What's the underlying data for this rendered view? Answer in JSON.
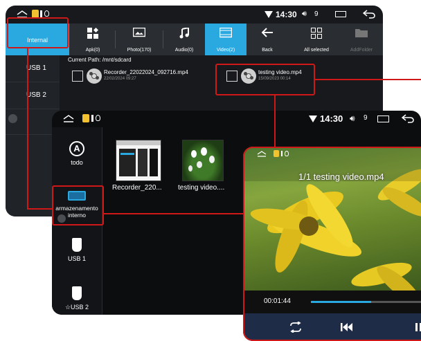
{
  "file_manager": {
    "status": {
      "time": "14:30",
      "volume": "9"
    },
    "tabs": {
      "internal": "Internal",
      "apk": "Apk(0)",
      "photo": "Photo(170)",
      "audio": "Audio(0)",
      "video": "Video(2)",
      "back": "Back",
      "all_selected": "All selected",
      "add_folder": "AddFolder"
    },
    "sidebar": [
      "USB 1",
      "USB 2"
    ],
    "current_path": "Current Path: /mnt/sdcard",
    "files": [
      {
        "name": "Recorder_22022024_092716.mp4",
        "date": "22/02/2024 09:27"
      },
      {
        "name": "testing video.mp4",
        "date": "15/09/2023 00:14"
      }
    ]
  },
  "media_launcher": {
    "status": {
      "time": "14:30",
      "volume": "9"
    },
    "rail": [
      {
        "label": "todo",
        "icon": "letter-a-circle-icon"
      },
      {
        "label": "armazenamento interno",
        "icon": "internal-storage-icon"
      },
      {
        "label": "USB 1",
        "icon": "usb-icon"
      },
      {
        "label": "☆USB 2",
        "icon": "usb-icon"
      }
    ],
    "thumbnails": [
      "Recorder_220...",
      "testing video...."
    ]
  },
  "video_player": {
    "title": "1/1 testing video.mp4",
    "elapsed": "00:01:44",
    "progress": 0.55,
    "controls": [
      "repeat-icon",
      "previous-icon",
      "play-pause-icon"
    ]
  },
  "colors": {
    "highlight": "#d01818",
    "accent": "#2aa8e0",
    "player_bar": "#1e2c48"
  }
}
